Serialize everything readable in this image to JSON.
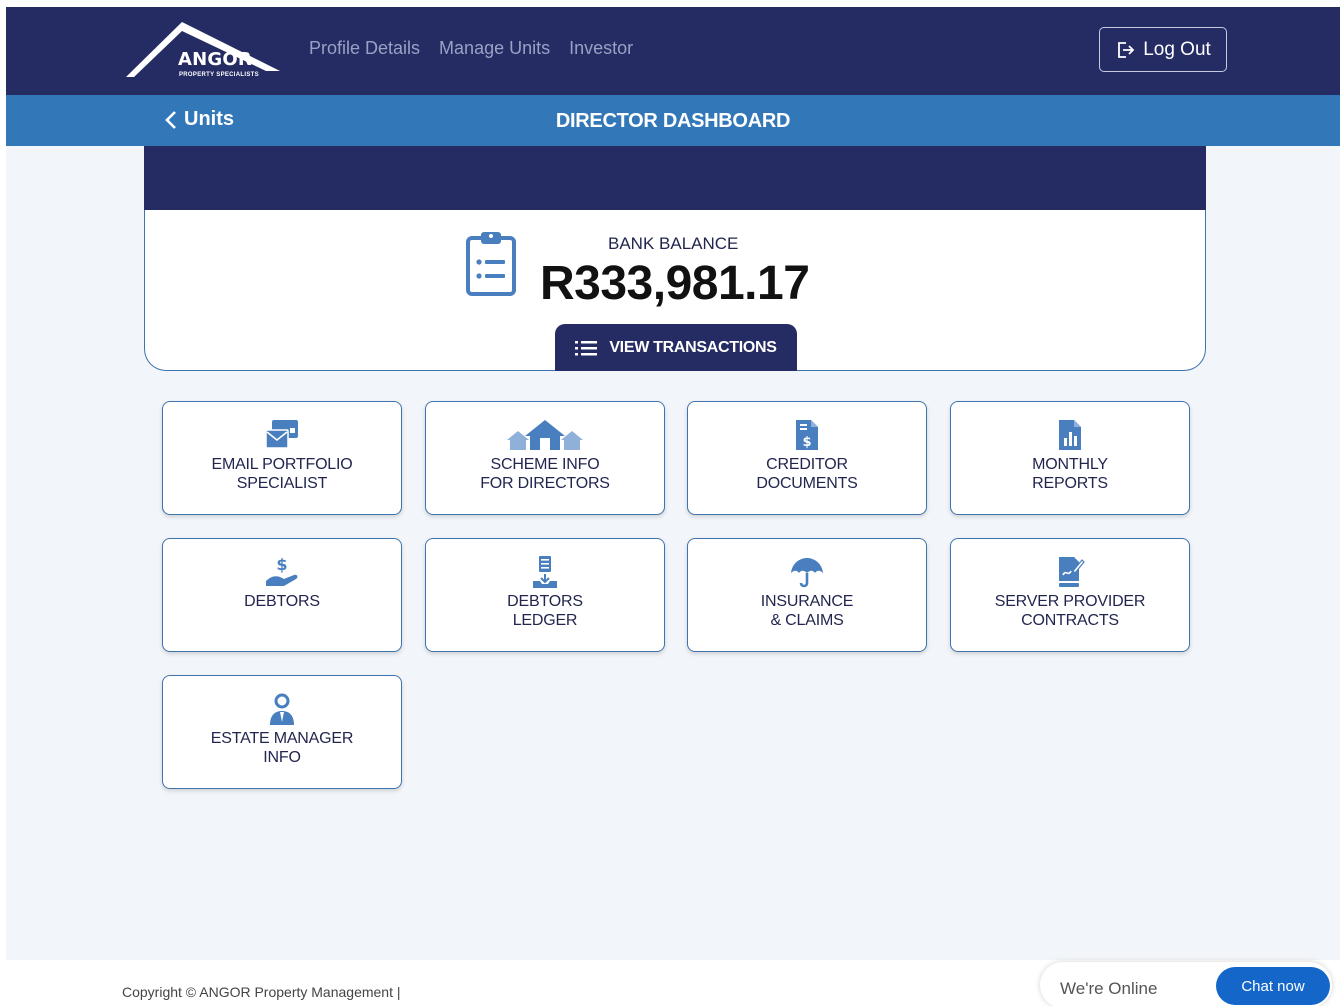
{
  "header": {
    "logo_text": "ANGOR",
    "logo_subtext": "PROPERTY SPECIALISTS",
    "nav": [
      "Profile Details",
      "Manage Units",
      "Investor"
    ],
    "logout_label": "Log Out"
  },
  "subheader": {
    "back_label": "Units",
    "title": "DIRECTOR DASHBOARD"
  },
  "balance": {
    "label": "BANK BALANCE",
    "value": "R333,981.17",
    "view_button": "VIEW TRANSACTIONS"
  },
  "tiles": [
    {
      "line1": "EMAIL PORTFOLIO",
      "line2": "SPECIALIST",
      "icon": "email-icon"
    },
    {
      "line1": "SCHEME INFO",
      "line2": "FOR DIRECTORS",
      "icon": "houses-icon"
    },
    {
      "line1": "CREDITOR",
      "line2": "DOCUMENTS",
      "icon": "invoice-icon"
    },
    {
      "line1": "MONTHLY",
      "line2": "REPORTS",
      "icon": "report-icon"
    },
    {
      "line1": "DEBTORS",
      "line2": "",
      "icon": "money-hand-icon"
    },
    {
      "line1": "DEBTORS",
      "line2": "LEDGER",
      "icon": "ledger-icon"
    },
    {
      "line1": "INSURANCE",
      "line2": "& CLAIMS",
      "icon": "umbrella-icon"
    },
    {
      "line1": "SERVER PROVIDER",
      "line2": "CONTRACTS",
      "icon": "contract-icon"
    },
    {
      "line1": "ESTATE MANAGER",
      "line2": "INFO",
      "icon": "manager-icon"
    }
  ],
  "footer": {
    "copyright": "Copyright © ANGOR Property Management |",
    "chat_status": "We're Online",
    "chat_button": "Chat now"
  },
  "colors": {
    "navy": "#252b63",
    "blue": "#3277b8",
    "icon_blue": "#4a7fbf",
    "chat_blue": "#1467c9"
  }
}
